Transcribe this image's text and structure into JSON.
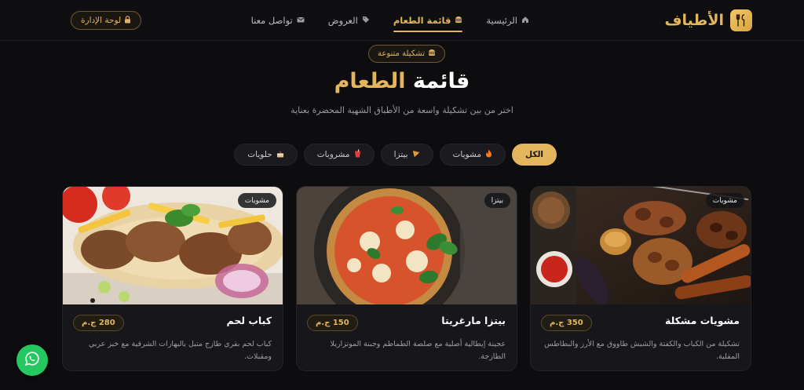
{
  "brand": {
    "name": "الأطياف",
    "accent": "#e3b55c"
  },
  "nav": {
    "items": [
      {
        "label": "الرئيسية",
        "icon": "home-icon"
      },
      {
        "label": "قائمة الطعام",
        "icon": "burger-icon",
        "active": true
      },
      {
        "label": "العروض",
        "icon": "tag-icon"
      },
      {
        "label": "تواصل معنا",
        "icon": "envelope-icon"
      }
    ],
    "admin_label": "لوحة الإدارة"
  },
  "hero": {
    "pill": "تشكيلة متنوعة",
    "title_part1": "قائمة",
    "title_part2": "الطعام",
    "subtitle": "اختر من بين تشكيلة واسعة من الأطباق الشهية المحضرة بعناية"
  },
  "filters": [
    {
      "label": "الكل",
      "icon": "",
      "active": true
    },
    {
      "label": "مشويات",
      "icon": "fire-icon"
    },
    {
      "label": "بيتزا",
      "icon": "pizza-icon"
    },
    {
      "label": "مشروبات",
      "icon": "drink-icon"
    },
    {
      "label": "حلويات",
      "icon": "cake-icon"
    }
  ],
  "cards": [
    {
      "tag": "مشويات",
      "name": "مشويات مشكلة",
      "price": "350 ج.م",
      "desc": "تشكيلة من الكباب والكفتة والشيش طاووق مع الأرز والبطاطس المقلية."
    },
    {
      "tag": "بيتزا",
      "name": "بيتزا مارغريتا",
      "price": "150 ج.م",
      "desc": "عجينة إيطالية أصلية مع صلصة الطماطم وجبنة الموتزاريلا الطازجة."
    },
    {
      "tag": "مشويات",
      "name": "كباب لحم",
      "price": "280 ج.م",
      "desc": "كباب لحم بقري طازج متبل بالبهارات الشرقية مع خبز عربي ومقبلات."
    }
  ]
}
